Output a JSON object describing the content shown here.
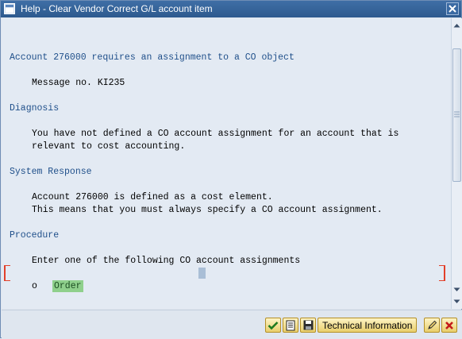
{
  "window": {
    "title": "Help - Clear Vendor Correct G/L account item"
  },
  "message": {
    "title": "Account 276000 requires an assignment to a CO object",
    "number": "Message no. KI235",
    "diagnosis_heading": "Diagnosis",
    "diagnosis_line1": "You have not defined a CO account assignment for an account that is",
    "diagnosis_line2": "relevant to cost accounting.",
    "system_response_heading": "System Response",
    "system_response_line1": "Account 276000 is defined as a cost element.",
    "system_response_line2": "This means that you must always specify a CO account assignment.",
    "procedure_heading": "Procedure",
    "procedure_line1": "Enter one of the following CO account assignments",
    "bullet": "o",
    "order_link": "Order"
  },
  "toolbar": {
    "confirm_icon": "checkmark-icon",
    "print_icon": "document-icon",
    "save_icon": "floppy-save-icon",
    "technical_info_label": "Technical Information",
    "edit_icon": "pencil-icon",
    "cancel_icon": "red-x-icon"
  },
  "colors": {
    "heading": "#1f4f8a",
    "order_highlight": "#8fd08c",
    "titlebar": "#2d5a8e"
  }
}
